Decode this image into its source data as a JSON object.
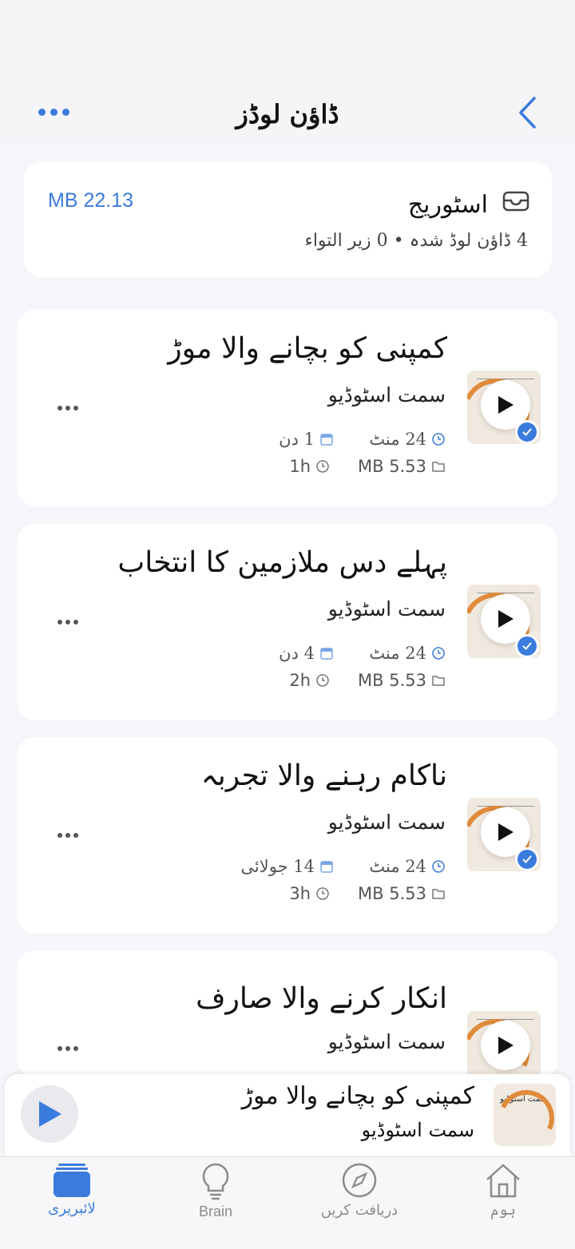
{
  "header": {
    "title": "ڈاؤن لوڈز"
  },
  "storage": {
    "title": "اسٹوریج",
    "subtitle": "4 ڈاؤن لوڈ شدہ • 0 زیر التواء",
    "size": "MB 22.13"
  },
  "items": [
    {
      "title": "کمپنی کو بچانے والا موڑ",
      "author": "سمت اسٹوڈیو",
      "duration": "24 منٹ",
      "date": "1 دن",
      "size": "MB 5.53",
      "age": "1h"
    },
    {
      "title": "پہلے دس ملازمین کا انتخاب",
      "author": "سمت اسٹوڈیو",
      "duration": "24 منٹ",
      "date": "4 دن",
      "size": "MB 5.53",
      "age": "2h"
    },
    {
      "title": "ناکام رہنے والا تجربہ",
      "author": "سمت اسٹوڈیو",
      "duration": "24 منٹ",
      "date": "14 جولائی",
      "size": "MB 5.53",
      "age": "3h"
    },
    {
      "title": "انکار کرنے والا صارف",
      "author": "سمت اسٹوڈیو"
    }
  ],
  "mini_player": {
    "title": "کمپنی کو بچانے والا موڑ",
    "author": "سمت اسٹوڈیو",
    "thumb_label": "سمت اسٹوڈیو"
  },
  "tabs": [
    {
      "label": "لائبریری",
      "icon": "library-icon",
      "active": true
    },
    {
      "label": "Brain",
      "icon": "bulb-icon"
    },
    {
      "label": "دریافت کریں",
      "icon": "compass-icon"
    },
    {
      "label": "ہوم",
      "icon": "home-icon"
    }
  ],
  "colors": {
    "accent": "#3a7bde",
    "thumb_arc": "#e08b3c",
    "background": "#f5f6fa"
  }
}
